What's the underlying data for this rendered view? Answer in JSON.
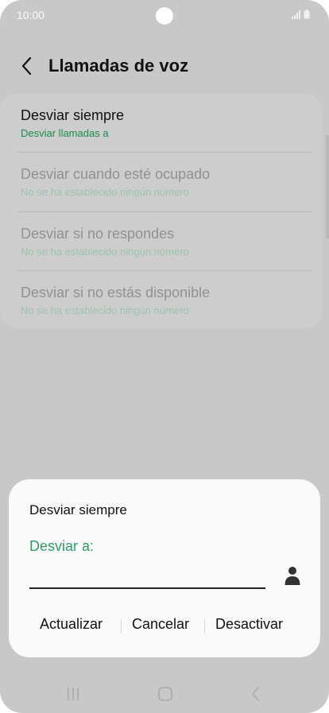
{
  "status_bar": {
    "time": "10:00"
  },
  "header": {
    "title": "Llamadas de voz"
  },
  "forward_options": [
    {
      "title": "Desviar siempre",
      "subtitle": "Desviar llamadas a"
    },
    {
      "title": "Desviar cuando esté ocupado",
      "subtitle": "No se ha establecido ningún número"
    },
    {
      "title": "Desviar si no respondes",
      "subtitle": "No se ha establecido ningún número"
    },
    {
      "title": "Desviar si no estás disponible",
      "subtitle": "No se ha establecido ningún número"
    }
  ],
  "dialog": {
    "title": "Desviar siempre",
    "field_label": "Desviar a:",
    "field_value": "",
    "update_label": "Actualizar",
    "cancel_label": "Cancelar",
    "disable_label": "Desactivar"
  },
  "icons": {
    "back": "chevron-left-icon",
    "contact": "person-icon",
    "recents": "recent-apps-icon",
    "home": "home-icon",
    "nav_back": "nav-back-icon"
  },
  "colors": {
    "accent_green": "#1b8a52",
    "label_green": "#2e9d63",
    "dimmed_background": "#c8c8c8",
    "dialog_background": "#fafafa"
  }
}
